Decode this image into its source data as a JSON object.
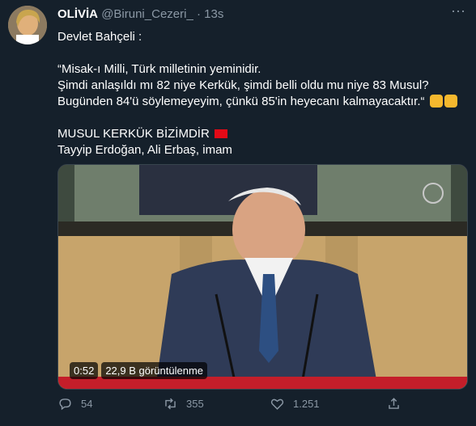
{
  "tweet": {
    "display_name": "OLİVİA",
    "handle": "@Biruni_Cezeri_",
    "time": "13s",
    "lines": [
      "Devlet Bahçeli :",
      "",
      "“Misak-ı Milli, Türk milletinin yeminidir.",
      "Şimdi anlaşıldı mı 82 niye Kerkük, şimdi belli oldu mu niye 83 Musul?",
      "Bugünden 84'ü söylemeyeyim, çünkü 85'in heyecanı kalmayacaktır.“",
      "",
      "MUSUL KERKÜK BİZİMDİR",
      "Tayyip Erdoğan, Ali Erbaş, imam"
    ]
  },
  "video": {
    "duration": "0:52",
    "views": "22,9 B görüntülenme"
  },
  "actions": {
    "replies": "54",
    "retweets": "355",
    "likes": "1.251"
  },
  "icons": [
    "more-icon",
    "reply-icon",
    "retweet-icon",
    "like-icon",
    "share-icon",
    "turkey-flag-icon",
    "clap-emoji-icon"
  ]
}
